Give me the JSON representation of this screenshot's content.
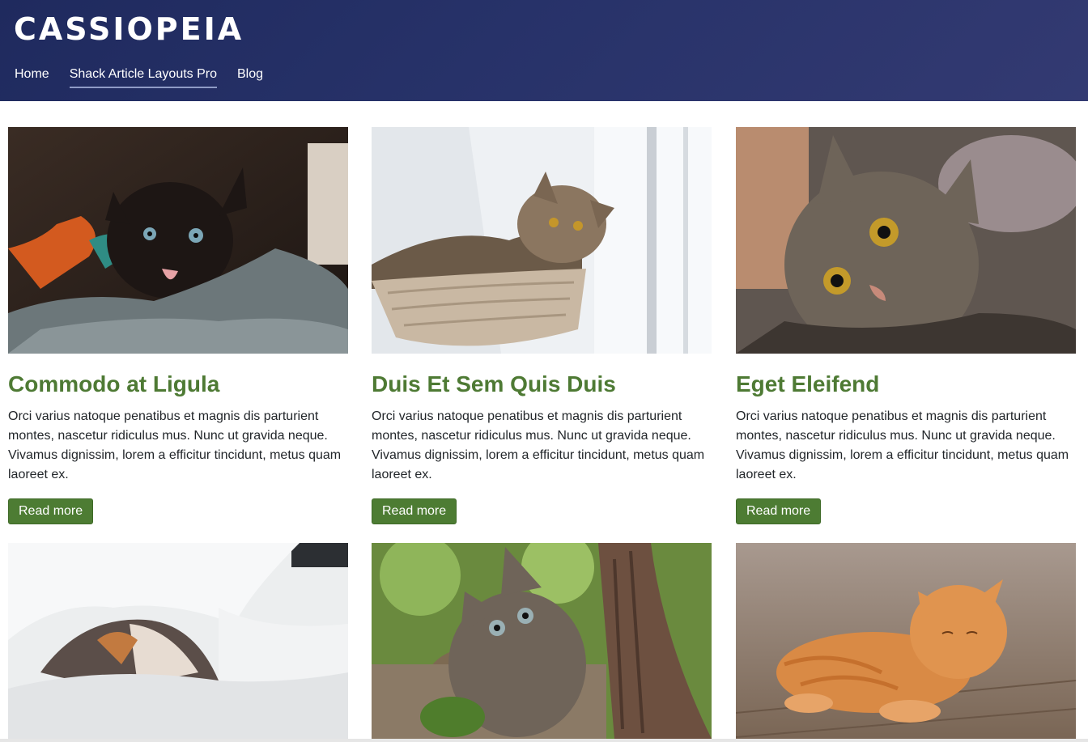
{
  "site": {
    "brand": "CASSIOPEIA"
  },
  "nav": {
    "items": [
      {
        "label": "Home",
        "active": false
      },
      {
        "label": "Shack Article Layouts Pro",
        "active": true
      },
      {
        "label": "Blog",
        "active": false
      }
    ]
  },
  "articles": [
    {
      "title": "Commodo at Ligula",
      "text": "Orci varius natoque penatibus et magnis dis parturient montes, nascetur ridiculus mus. Nunc ut gravida neque. Vivamus dignissim, lorem a efficitur tincidunt, metus quam laoreet ex.",
      "button": "Read more",
      "image": "black-kitten-on-blanket"
    },
    {
      "title": "Duis Et Sem Quis Duis",
      "text": "Orci varius natoque penatibus et magnis dis parturient montes, nascetur ridiculus mus. Nunc ut gravida neque. Vivamus dignissim, lorem a efficitur tincidunt, metus quam laoreet ex.",
      "button": "Read more",
      "image": "tabby-cat-in-window-basket"
    },
    {
      "title": "Eget Eleifend",
      "text": "Orci varius natoque penatibus et magnis dis parturient montes, nascetur ridiculus mus. Nunc ut gravida neque. Vivamus dignissim, lorem a efficitur tincidunt, metus quam laoreet ex.",
      "button": "Read more",
      "image": "tabby-cat-closeup"
    },
    {
      "image": "calico-cat-under-duvet"
    },
    {
      "image": "tabby-kitten-by-tree"
    },
    {
      "image": "orange-cat-on-floor"
    }
  ],
  "colors": {
    "header": "#273269",
    "accent": "#4d7c33",
    "title": "#4e7a34"
  }
}
